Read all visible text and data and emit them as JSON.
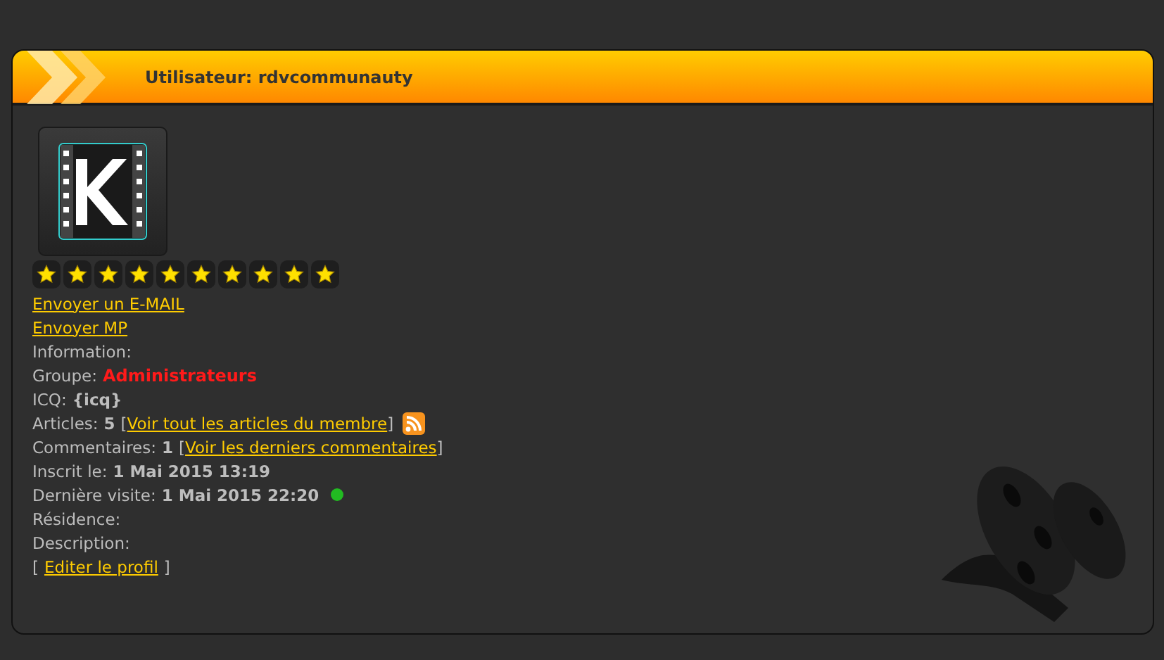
{
  "header": {
    "title": "Utilisateur: rdvcommunauty"
  },
  "profile": {
    "stars": 10,
    "links": [
      "Envoyer un E-MAIL",
      "Envoyer MP"
    ],
    "fields": [
      {
        "kind": "plain",
        "label": "Information:"
      },
      {
        "kind": "group",
        "label": "Groupe:",
        "value": "Administrateurs"
      },
      {
        "kind": "value",
        "label": "ICQ:",
        "value": "{icq}"
      },
      {
        "kind": "linked",
        "label": "Articles:",
        "value": "5",
        "open": "[",
        "link": "Voir tout les articles du membre",
        "close": "]",
        "rss": true
      },
      {
        "kind": "linked",
        "label": "Commentaires:",
        "value": "1",
        "open": "[",
        "link": "Voir les derniers commentaires",
        "close": "]",
        "rss": false
      },
      {
        "kind": "value",
        "label": "Inscrit le:",
        "value": "1 Mai 2015 13:19"
      },
      {
        "kind": "value",
        "label": "Dernière visite:",
        "value": "1 Mai 2015 22:20",
        "online": true
      },
      {
        "kind": "plain",
        "label": "Résidence:"
      },
      {
        "kind": "plain",
        "label": "Description:"
      },
      {
        "kind": "action",
        "open": "[",
        "link": "Editer le profil",
        "close": "]"
      }
    ]
  }
}
